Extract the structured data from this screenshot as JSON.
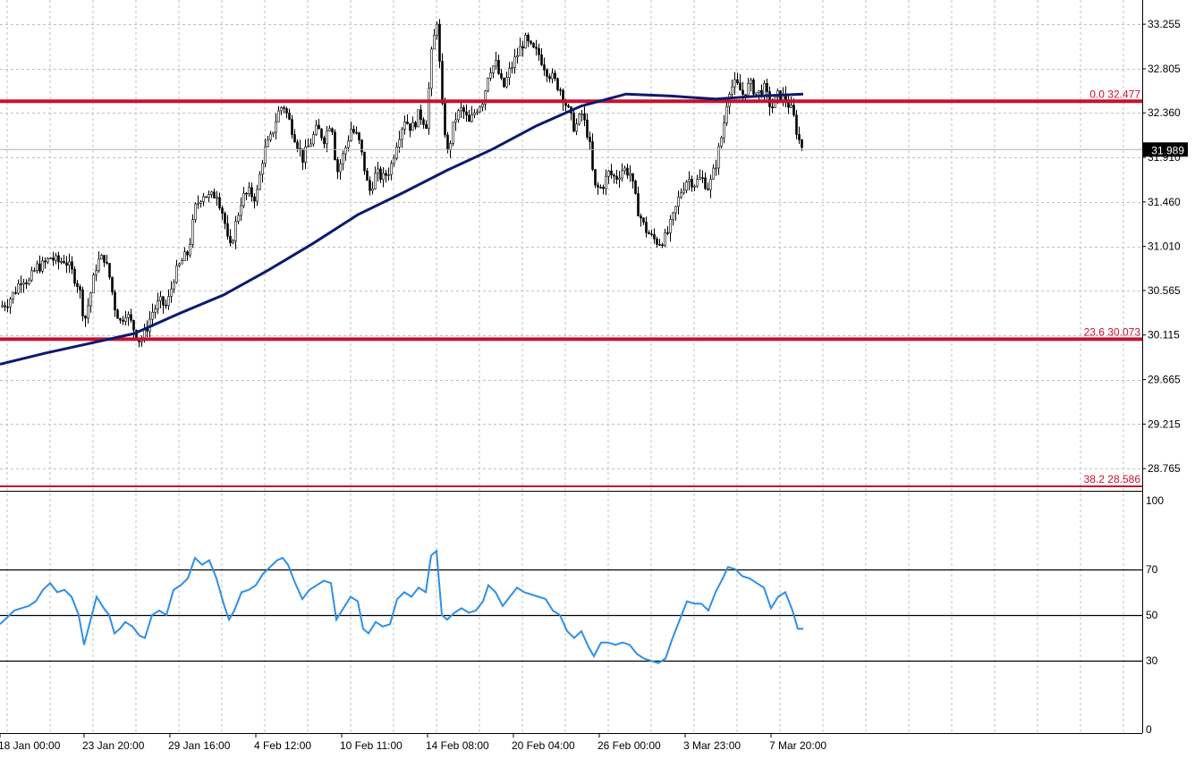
{
  "colors": {
    "background": "#ffffff",
    "grid": "#c0c0c0",
    "candle": "#000000",
    "moving_average": "#0b1a6e",
    "fibonacci": "#c8102e",
    "rsi": "#2f8fe6",
    "rsi_levels": "#000000",
    "current_price_box": "#000000",
    "current_price_text": "#ffffff"
  },
  "chart_data": [
    {
      "type": "candlestick",
      "panel": "price",
      "y_axis_ticks": [
        "33.255",
        "32.805",
        "32.360",
        "31.910",
        "31.460",
        "31.010",
        "30.565",
        "30.115",
        "29.665",
        "29.215",
        "28.765"
      ],
      "ylim": [
        28.55,
        33.5
      ],
      "x_tick_labels": [
        "18 Jan 00:00",
        "23 Jan 20:00",
        "29 Jan 16:00",
        "4 Feb 12:00",
        "10 Feb 11:00",
        "14 Feb 08:00",
        "20 Feb 04:00",
        "26 Feb 00:00",
        "3 Mar 23:00",
        "7 Mar 20:00"
      ],
      "current_price": "31.989",
      "current_price_value": 31.989,
      "fibonacci_levels": [
        {
          "label": "0.0 32.477",
          "value": 32.477
        },
        {
          "label": "23.6 30.073",
          "value": 30.073
        },
        {
          "label": "38.2 28.586",
          "value": 28.586
        }
      ],
      "close_path": [
        [
          0,
          30.4
        ],
        [
          8,
          30.45
        ],
        [
          16,
          30.55
        ],
        [
          24,
          30.7
        ],
        [
          32,
          30.65
        ],
        [
          40,
          30.8
        ],
        [
          48,
          30.82
        ],
        [
          56,
          30.9
        ],
        [
          64,
          30.85
        ],
        [
          72,
          30.88
        ],
        [
          80,
          30.75
        ],
        [
          88,
          30.6
        ],
        [
          94,
          30.25
        ],
        [
          100,
          30.5
        ],
        [
          108,
          30.85
        ],
        [
          116,
          30.9
        ],
        [
          122,
          30.7
        ],
        [
          128,
          30.4
        ],
        [
          134,
          30.25
        ],
        [
          140,
          30.35
        ],
        [
          148,
          30.2
        ],
        [
          156,
          30.05
        ],
        [
          162,
          30.15
        ],
        [
          170,
          30.35
        ],
        [
          178,
          30.45
        ],
        [
          186,
          30.4
        ],
        [
          194,
          30.7
        ],
        [
          202,
          30.85
        ],
        [
          210,
          30.95
        ],
        [
          218,
          31.4
        ],
        [
          226,
          31.55
        ],
        [
          234,
          31.5
        ],
        [
          242,
          31.55
        ],
        [
          250,
          31.3
        ],
        [
          256,
          30.95
        ],
        [
          262,
          31.2
        ],
        [
          270,
          31.5
        ],
        [
          278,
          31.55
        ],
        [
          286,
          31.5
        ],
        [
          294,
          31.95
        ],
        [
          302,
          32.1
        ],
        [
          310,
          32.35
        ],
        [
          316,
          32.45
        ],
        [
          322,
          32.3
        ],
        [
          330,
          32.1
        ],
        [
          338,
          31.9
        ],
        [
          346,
          32.05
        ],
        [
          354,
          32.2
        ],
        [
          362,
          32.1
        ],
        [
          370,
          32.3
        ],
        [
          376,
          31.75
        ],
        [
          384,
          31.95
        ],
        [
          392,
          32.2
        ],
        [
          400,
          32.1
        ],
        [
          406,
          31.85
        ],
        [
          412,
          31.55
        ],
        [
          420,
          31.75
        ],
        [
          428,
          31.7
        ],
        [
          436,
          31.8
        ],
        [
          444,
          32.1
        ],
        [
          452,
          32.3
        ],
        [
          460,
          32.2
        ],
        [
          468,
          32.35
        ],
        [
          476,
          32.25
        ],
        [
          482,
          32.95
        ],
        [
          488,
          33.3
        ],
        [
          494,
          32.4
        ],
        [
          500,
          31.95
        ],
        [
          508,
          32.3
        ],
        [
          516,
          32.4
        ],
        [
          524,
          32.25
        ],
        [
          532,
          32.4
        ],
        [
          540,
          32.5
        ],
        [
          546,
          32.8
        ],
        [
          554,
          32.85
        ],
        [
          562,
          32.6
        ],
        [
          570,
          32.8
        ],
        [
          578,
          32.95
        ],
        [
          586,
          33.1
        ],
        [
          594,
          33.0
        ],
        [
          602,
          32.95
        ],
        [
          610,
          32.8
        ],
        [
          618,
          32.7
        ],
        [
          626,
          32.6
        ],
        [
          634,
          32.4
        ],
        [
          642,
          32.2
        ],
        [
          650,
          32.35
        ],
        [
          658,
          32.1
        ],
        [
          664,
          31.6
        ],
        [
          672,
          31.6
        ],
        [
          680,
          31.75
        ],
        [
          688,
          31.7
        ],
        [
          696,
          31.8
        ],
        [
          704,
          31.75
        ],
        [
          712,
          31.4
        ],
        [
          720,
          31.2
        ],
        [
          728,
          31.1
        ],
        [
          736,
          31.05
        ],
        [
          744,
          31.1
        ],
        [
          752,
          31.3
        ],
        [
          760,
          31.55
        ],
        [
          768,
          31.7
        ],
        [
          776,
          31.65
        ],
        [
          784,
          31.7
        ],
        [
          792,
          31.6
        ],
        [
          800,
          31.85
        ],
        [
          808,
          32.2
        ],
        [
          814,
          32.6
        ],
        [
          822,
          32.65
        ],
        [
          830,
          32.55
        ],
        [
          838,
          32.65
        ],
        [
          846,
          32.55
        ],
        [
          854,
          32.6
        ],
        [
          862,
          32.4
        ],
        [
          870,
          32.55
        ],
        [
          878,
          32.5
        ],
        [
          886,
          32.35
        ],
        [
          892,
          32.1
        ],
        [
          898,
          31.99
        ]
      ],
      "moving_average": [
        [
          0,
          29.82
        ],
        [
          50,
          29.93
        ],
        [
          100,
          30.03
        ],
        [
          150,
          30.13
        ],
        [
          200,
          30.33
        ],
        [
          250,
          30.52
        ],
        [
          300,
          30.77
        ],
        [
          350,
          31.04
        ],
        [
          400,
          31.33
        ],
        [
          450,
          31.55
        ],
        [
          500,
          31.78
        ],
        [
          550,
          31.99
        ],
        [
          600,
          32.23
        ],
        [
          650,
          32.43
        ],
        [
          700,
          32.55
        ],
        [
          750,
          32.53
        ],
        [
          800,
          32.5
        ],
        [
          850,
          32.53
        ],
        [
          898,
          32.55
        ]
      ]
    },
    {
      "type": "line",
      "panel": "rsi",
      "y_axis_ticks": [
        "100",
        "70",
        "50",
        "30",
        "0"
      ],
      "levels": [
        70,
        50,
        30
      ],
      "ylim": [
        0,
        100
      ],
      "series": [
        {
          "values": [
            [
              0,
              46
            ],
            [
              8,
              49
            ],
            [
              16,
              52
            ],
            [
              24,
              53
            ],
            [
              32,
              54
            ],
            [
              40,
              56
            ],
            [
              48,
              61
            ],
            [
              56,
              64
            ],
            [
              64,
              60
            ],
            [
              72,
              61
            ],
            [
              80,
              58
            ],
            [
              88,
              50
            ],
            [
              94,
              37
            ],
            [
              100,
              46
            ],
            [
              108,
              58
            ],
            [
              116,
              53
            ],
            [
              122,
              50
            ],
            [
              128,
              42
            ],
            [
              134,
              44
            ],
            [
              140,
              47
            ],
            [
              148,
              45
            ],
            [
              156,
              41
            ],
            [
              162,
              40
            ],
            [
              170,
              50
            ],
            [
              178,
              52
            ],
            [
              186,
              50
            ],
            [
              194,
              61
            ],
            [
              202,
              63
            ],
            [
              210,
              66
            ],
            [
              218,
              75
            ],
            [
              226,
              72
            ],
            [
              234,
              74
            ],
            [
              242,
              66
            ],
            [
              250,
              55
            ],
            [
              256,
              48
            ],
            [
              262,
              52
            ],
            [
              270,
              60
            ],
            [
              278,
              61
            ],
            [
              286,
              63
            ],
            [
              294,
              68
            ],
            [
              302,
              71
            ],
            [
              310,
              74
            ],
            [
              316,
              75
            ],
            [
              322,
              72
            ],
            [
              330,
              64
            ],
            [
              338,
              57
            ],
            [
              346,
              61
            ],
            [
              354,
              63
            ],
            [
              362,
              65
            ],
            [
              370,
              64
            ],
            [
              376,
              48
            ],
            [
              384,
              53
            ],
            [
              392,
              58
            ],
            [
              400,
              56
            ],
            [
              406,
              44
            ],
            [
              412,
              42
            ],
            [
              420,
              47
            ],
            [
              428,
              45
            ],
            [
              436,
              46
            ],
            [
              444,
              57
            ],
            [
              452,
              60
            ],
            [
              460,
              58
            ],
            [
              468,
              62
            ],
            [
              476,
              60
            ],
            [
              482,
              76
            ],
            [
              488,
              78
            ],
            [
              494,
              50
            ],
            [
              500,
              48
            ],
            [
              508,
              51
            ],
            [
              516,
              53
            ],
            [
              524,
              51
            ],
            [
              532,
              52
            ],
            [
              540,
              56
            ],
            [
              546,
              63
            ],
            [
              554,
              60
            ],
            [
              562,
              54
            ],
            [
              570,
              58
            ],
            [
              578,
              62
            ],
            [
              586,
              60
            ],
            [
              594,
              59
            ],
            [
              602,
              58
            ],
            [
              610,
              57
            ],
            [
              618,
              52
            ],
            [
              626,
              50
            ],
            [
              634,
              43
            ],
            [
              642,
              40
            ],
            [
              650,
              43
            ],
            [
              658,
              36
            ],
            [
              664,
              32
            ],
            [
              672,
              38
            ],
            [
              680,
              38
            ],
            [
              688,
              37
            ],
            [
              696,
              38
            ],
            [
              704,
              37
            ],
            [
              712,
              33
            ],
            [
              720,
              31
            ],
            [
              728,
              30
            ],
            [
              736,
              29
            ],
            [
              744,
              31
            ],
            [
              752,
              40
            ],
            [
              760,
              48
            ],
            [
              768,
              56
            ],
            [
              776,
              55
            ],
            [
              784,
              55
            ],
            [
              792,
              52
            ],
            [
              800,
              60
            ],
            [
              808,
              66
            ],
            [
              814,
              71
            ],
            [
              822,
              70
            ],
            [
              830,
              67
            ],
            [
              838,
              66
            ],
            [
              846,
              64
            ],
            [
              854,
              62
            ],
            [
              862,
              53
            ],
            [
              870,
              58
            ],
            [
              878,
              60
            ],
            [
              886,
              52
            ],
            [
              892,
              44
            ],
            [
              898,
              44
            ]
          ]
        }
      ]
    }
  ]
}
